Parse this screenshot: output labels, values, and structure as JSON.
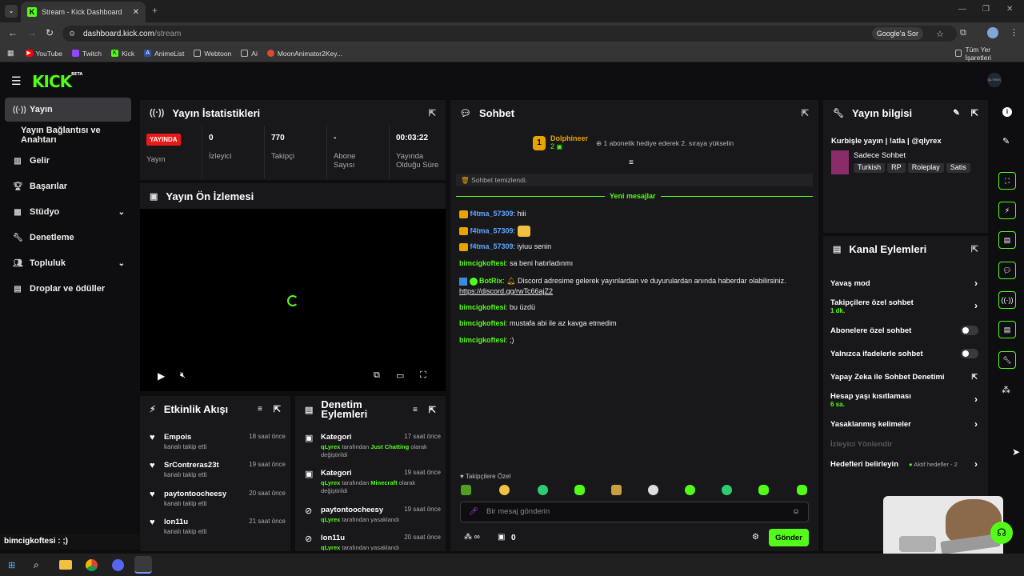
{
  "browser": {
    "tab_title": "Stream - Kick Dashboard",
    "url_host": "dashboard.kick.com",
    "url_path": "/stream",
    "google_btn": "Google'a Sor",
    "bookmarks": [
      "YouTube",
      "Twitch",
      "Kick",
      "AnimeList",
      "Webtoon",
      "Ai",
      "MoonAnimator2Key..."
    ],
    "all_bookmarks": "Tüm Yer İşaretleri"
  },
  "app": {
    "logo": "KICK",
    "logo_sup": "BETA",
    "avatar_text": "QLYREX"
  },
  "sidebar": {
    "items": [
      {
        "label": "Yayın",
        "icon": "broadcast-icon"
      },
      {
        "label": "Yayın Bağlantısı ve Anahtarı",
        "icon": ""
      },
      {
        "label": "Gelir",
        "icon": "chart-icon"
      },
      {
        "label": "Başarılar",
        "icon": "trophy-icon"
      },
      {
        "label": "Stüdyo",
        "icon": "studio-icon"
      },
      {
        "label": "Denetleme",
        "icon": "wrench-icon"
      },
      {
        "label": "Topluluk",
        "icon": "users-icon"
      },
      {
        "label": "Droplar ve ödüller",
        "icon": "gift-icon"
      }
    ]
  },
  "stats": {
    "title": "Yayın İstatistikleri",
    "live_badge": "YAYINDA",
    "status_label": "Yayın",
    "viewers_value": "0",
    "viewers_label": "İzleyici",
    "followers_value": "770",
    "followers_label": "Takipçi",
    "subs_value": "-",
    "subs_label": "Abone Sayısı",
    "uptime_value": "00:03:22",
    "uptime_label": "Yayında Olduğu Süre"
  },
  "preview": {
    "title": "Yayın Ön İzlemesi"
  },
  "activity": {
    "title": "Etkinlik Akışı",
    "items": [
      {
        "name": "Empois",
        "sub": "kanalı takip etti",
        "time": "18 saat önce"
      },
      {
        "name": "SrContreras23t",
        "sub": "kanalı takip etti",
        "time": "19 saat önce"
      },
      {
        "name": "paytontoocheesy",
        "sub": "kanalı takip etti",
        "time": "20 saat önce"
      },
      {
        "name": "lon11u",
        "sub": "kanalı takip etti",
        "time": "21 saat önce"
      }
    ]
  },
  "modactions": {
    "title1": "Denetim",
    "title2": "Eylemleri",
    "items": [
      {
        "name": "Kategori",
        "time": "17 saat önce",
        "by": "qLyrex",
        "mid": "tarafından",
        "hl": "Just Chatting",
        "end": "olarak değiştirildi"
      },
      {
        "name": "Kategori",
        "time": "19 saat önce",
        "by": "qLyrex",
        "mid": "tarafından",
        "hl": "Minecraft",
        "end": "olarak değiştirildi"
      },
      {
        "name": "paytontoocheesy",
        "time": "19 saat önce",
        "by": "qLyrex",
        "mid": "tarafından yasaklandı",
        "hl": "",
        "end": ""
      },
      {
        "name": "lon11u",
        "time": "20 saat önce",
        "by": "qLyrex",
        "mid": "tarafından yasaklandı",
        "hl": "",
        "end": ""
      }
    ]
  },
  "chat": {
    "title": "Sohbet",
    "pinned_user": "Dolphineer",
    "pinned_count": "2",
    "pinned_rank": "1",
    "pinned_text": "1 abonelik hediye ederek 2. sıraya yükselin",
    "cleared": "Sohbet temizlendi.",
    "new_messages": "Yeni mesajlar",
    "messages": [
      {
        "user": "f4tma_57309",
        "text": "hiii"
      },
      {
        "user": "f4tma_57309",
        "text": ""
      },
      {
        "user": "f4tma_57309",
        "text": "iyiuu senin"
      },
      {
        "user": "bimcigkoftesi",
        "text": "sa beni hatırladınmı"
      },
      {
        "user": "BotRix",
        "text": "Discord adresime gelerek yayınlardan ve duyurulardan anında haberdar olabilirsiniz.",
        "link": "https://discord.gg/rwTc66ajZ2"
      },
      {
        "user": "bimcigkoftesi",
        "text": "bu üzdü"
      },
      {
        "user": "bimcigkoftesi",
        "text": "mustafa abi ile az kavga etmedim"
      },
      {
        "user": "bimcigkoftesi",
        "text": ";)"
      }
    ],
    "followers_only_label": "Takipçilere Özel",
    "input_placeholder": "Bir mesaj gönderin",
    "count_zero": "0",
    "send": "Gönder"
  },
  "streaminfo": {
    "title": "Yayın bilgisi",
    "stream_title": "Kurbişle yayın | !atla | @qlyrex",
    "category": "Sadece Sohbet",
    "tags": [
      "Turkish",
      "RP",
      "Roleplay",
      "Satis"
    ]
  },
  "channel_actions": {
    "title": "Kanal Eylemleri",
    "rows": [
      {
        "label": "Yavaş mod",
        "sub": "",
        "ctrl": "chevron"
      },
      {
        "label": "Takipçilere özel sohbet",
        "sub": "1 dk.",
        "ctrl": "chevron"
      },
      {
        "label": "Abonelere özel sohbet",
        "sub": "",
        "ctrl": "toggle"
      },
      {
        "label": "Yalnızca ifadelerle sohbet",
        "sub": "",
        "ctrl": "toggle"
      },
      {
        "label": "Yapay Zeka ile Sohbet Denetimi",
        "sub": "",
        "ctrl": "popout"
      },
      {
        "label": "Hesap yaşı kısıtlaması",
        "sub": "6 sa.",
        "ctrl": "chevron"
      },
      {
        "label": "Yasaklanmış kelimeler",
        "sub": "",
        "ctrl": "chevron"
      },
      {
        "label": "İzleyici Yönlendir",
        "sub": "",
        "ctrl": "none"
      },
      {
        "label": "Hedefleri belirleyin",
        "sub": "",
        "ctrl": "goal"
      }
    ],
    "goal_text": "Aktif hedefler - 2"
  },
  "overlay_chat": "bimcigkoftesi : ;)",
  "colors": {
    "accent": "#53fc18",
    "panel": "#18181b",
    "bg": "#0e0e10",
    "live": "#e91916"
  }
}
